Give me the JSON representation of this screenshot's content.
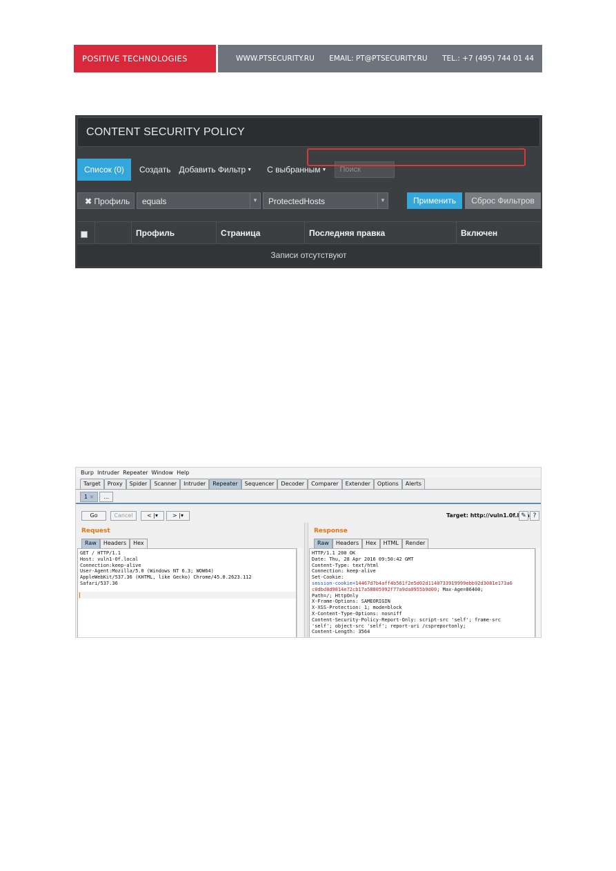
{
  "banner": {
    "brand": "POSITIVE TECHNOLOGIES",
    "website": "WWW.PTSECURITY.RU",
    "email": "EMAIL: PT@PTSECURITY.RU",
    "phone": "TEL.: +7 (495) 744 01 44",
    "brand_color": "#d8283a"
  },
  "csp_panel": {
    "title": "CONTENT SECURITY POLICY",
    "toolbar": {
      "list_tab": "Список (0)",
      "create": "Создать",
      "add_filter": "Добавить Фильтр",
      "with_selected": "С выбранным",
      "search_placeholder": "Поиск"
    },
    "filter": {
      "profile_button": "Профиль",
      "operator": "equals",
      "value": "ProtectedHosts",
      "apply": "Применить",
      "reset": "Сброс Фильтров"
    },
    "table": {
      "columns": [
        "",
        "",
        "Профиль",
        "Страница",
        "Последняя правка",
        "Включен"
      ],
      "empty_message": "Записи отсутствуют"
    },
    "accent_color": "#33a6dc"
  },
  "burp": {
    "menu": [
      "Burp",
      "Intruder",
      "Repeater",
      "Window",
      "Help"
    ],
    "tabs": [
      "Target",
      "Proxy",
      "Spider",
      "Scanner",
      "Intruder",
      "Repeater",
      "Sequencer",
      "Decoder",
      "Comparer",
      "Extender",
      "Options",
      "Alerts"
    ],
    "active_tab": "Repeater",
    "subtabs": [
      "1",
      "..."
    ],
    "go": "Go",
    "cancel": "Cancel",
    "back": "<",
    "forward": ">",
    "target": "Target: http://vuln1.0f.local",
    "request": {
      "title": "Request",
      "tabs": [
        "Raw",
        "Headers",
        "Hex"
      ],
      "lines": [
        "GET / HTTP/1.1",
        "Host: vuln1-0f.local",
        "Connection:keep-alive",
        "User-Agent:Mozilla/5.0 (Windows NT 6.3; WOW64)",
        "AppleWebKit/537.36 (KHTML, like Gecko) Chrome/45.0.2623.112",
        "Safari/537.36"
      ]
    },
    "response": {
      "title": "Response",
      "tabs": [
        "Raw",
        "Headers",
        "Hex",
        "HTML",
        "Render"
      ],
      "lines_before": [
        "HTTP/1.1 200 OK",
        "Date: Thu, 28 Apr 2016 09:50:42 GMT",
        "Content-Type: text/html",
        "Connection: keep-alive",
        "Set-Cookie:"
      ],
      "cookie_name": "session-cookie=",
      "cookie_value_1": "14467d7b4aff4b561f2e5d02d1140733919999ebb92d3081e173a6",
      "cookie_value_2": "c0dbd8d9814e72cb17a58805992f77a9da0955b9d00",
      "cookie_tail": "; Max-Age=86400;",
      "lines_after": [
        "Path=/; HttpOnly",
        "X-Frame-Options: SAMEORIGIN",
        "X-XSS-Protection: 1; mode=block",
        "X-Content-Type-Options: nosniff",
        "Content-Security-Policy-Report-Only: script-src 'self'; frame-src",
        "'self'; object-src 'self'; report-uri /cspreportonly;",
        "Content-Length: 3564"
      ],
      "highlight_color": "#d83a36"
    }
  }
}
